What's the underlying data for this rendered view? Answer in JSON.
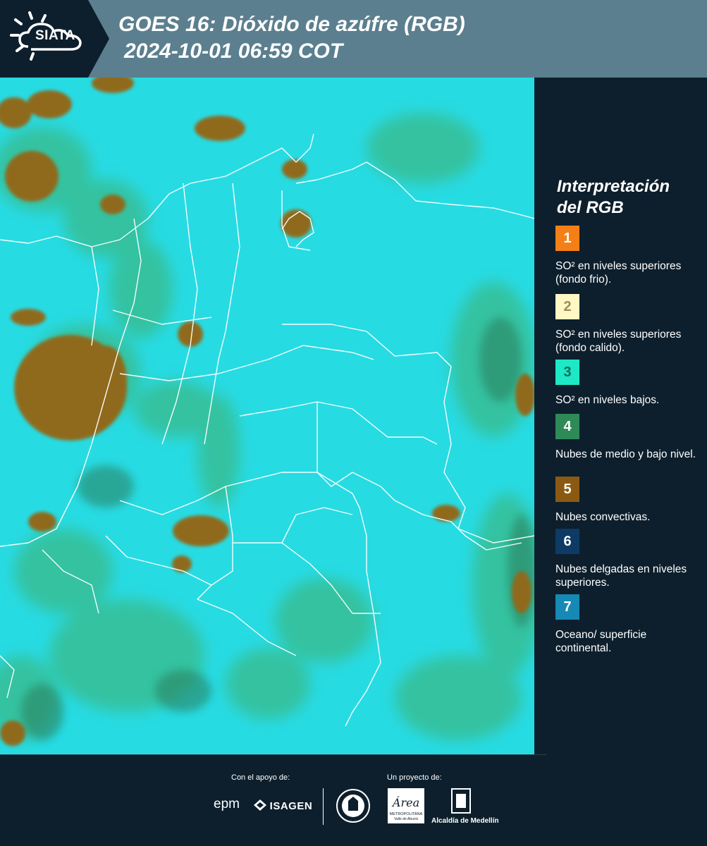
{
  "header": {
    "logo_text": "SIATA",
    "title_line1": "GOES 16: Dióxido de azúfre (RGB)",
    "title_line2": "2024-10-01 06:59 COT",
    "background_color": "#5b7f8e"
  },
  "map": {
    "icon": "satellite-map",
    "base_color": "#22d7e0"
  },
  "legend": {
    "title_line1": "Interpretación",
    "title_line2": "del RGB",
    "items": [
      {
        "number": "1",
        "color": "#f57f17",
        "text_color": "#ffffff",
        "description": "SO² en niveles superiores (fondo frio)."
      },
      {
        "number": "2",
        "color": "#fff8c4",
        "text_color": "#9a8f5a",
        "description": "SO² en niveles superiores (fondo calido)."
      },
      {
        "number": "3",
        "color": "#1de9c6",
        "text_color": "#0d6e5e",
        "description": "SO² en niveles bajos."
      },
      {
        "number": "4",
        "color": "#2e8b57",
        "text_color": "#ffffff",
        "description": "Nubes de medio y bajo nivel."
      },
      {
        "number": "5",
        "color": "#8b5a12",
        "text_color": "#ffffff",
        "description": "Nubes convectivas."
      },
      {
        "number": "6",
        "color": "#0d3b66",
        "text_color": "#ffffff",
        "description": "Nubes delgadas en niveles superiores."
      },
      {
        "number": "7",
        "color": "#1689b5",
        "text_color": "#ffffff",
        "description": "Oceano/ superficie continental."
      }
    ]
  },
  "footer": {
    "support_label": "Con el apoyo de:",
    "project_label": "Un proyecto de:",
    "epm": "epm",
    "isagen": "ISAGEN",
    "area_text": "Área",
    "area_subtext": "METROPOLITANA",
    "area_subtext2": "Valle de Aburrá",
    "alcaldia": "Alcaldía de Medellín"
  }
}
